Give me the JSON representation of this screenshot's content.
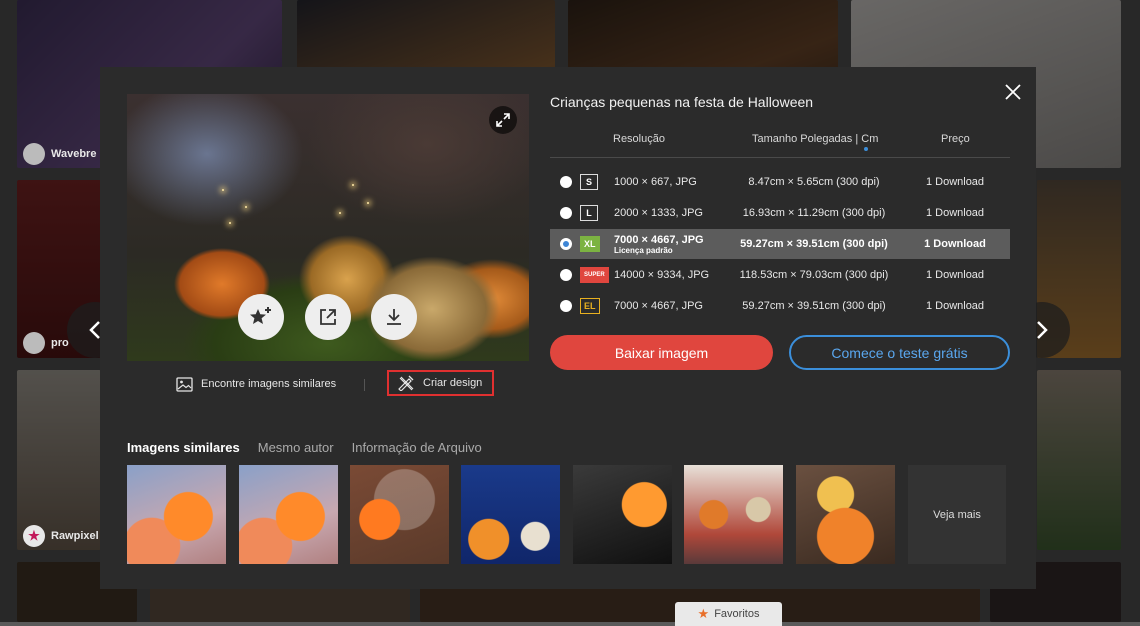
{
  "background": {
    "credits": [
      "Wavebre",
      "pro",
      "Rawpixel"
    ],
    "favorites_tab": "Favoritos"
  },
  "modal": {
    "title": "Crianças pequenas na festa de Halloween",
    "table": {
      "headers": {
        "resolution": "Resolução",
        "size": "Tamanho Polegadas | Cm",
        "price": "Preço"
      },
      "rows": [
        {
          "badge": "S",
          "badge_color": "#2b2b2b",
          "resolution": "1000 × 667, JPG",
          "sub": "",
          "size": "8.47cm × 5.65cm (300 dpi)",
          "price": "1 Download",
          "selected": false
        },
        {
          "badge": "L",
          "badge_color": "#2b2b2b",
          "resolution": "2000 × 1333, JPG",
          "sub": "",
          "size": "16.93cm × 11.29cm (300 dpi)",
          "price": "1 Download",
          "selected": false
        },
        {
          "badge": "XL",
          "badge_color": "#7cb342",
          "resolution": "7000 × 4667, JPG",
          "sub": "Licença padrão",
          "size": "59.27cm × 39.51cm (300 dpi)",
          "price": "1 Download",
          "selected": true
        },
        {
          "badge": "SUPER",
          "badge_color": "#e0463e",
          "resolution": "14000 × 9334, JPG",
          "sub": "",
          "size": "118.53cm × 79.03cm (300 dpi)",
          "price": "1 Download",
          "selected": false
        },
        {
          "badge": "EL",
          "badge_color": "#2b2b2b",
          "resolution": "7000 × 4667, JPG",
          "sub": "",
          "size": "59.27cm × 39.51cm (300 dpi)",
          "price": "1 Download",
          "selected": false
        }
      ]
    },
    "buttons": {
      "download": "Baixar imagem",
      "trial": "Comece o teste grátis"
    },
    "below_preview": {
      "similar": "Encontre imagens similares",
      "design": "Criar design"
    },
    "tabs": [
      "Imagens similares",
      "Mesmo autor",
      "Informação de Arquivo"
    ],
    "see_more": "Veja mais",
    "colors": {
      "accent_red": "#e0463e",
      "accent_blue": "#3b8fdb",
      "modal_bg": "#2b2b2b"
    }
  }
}
